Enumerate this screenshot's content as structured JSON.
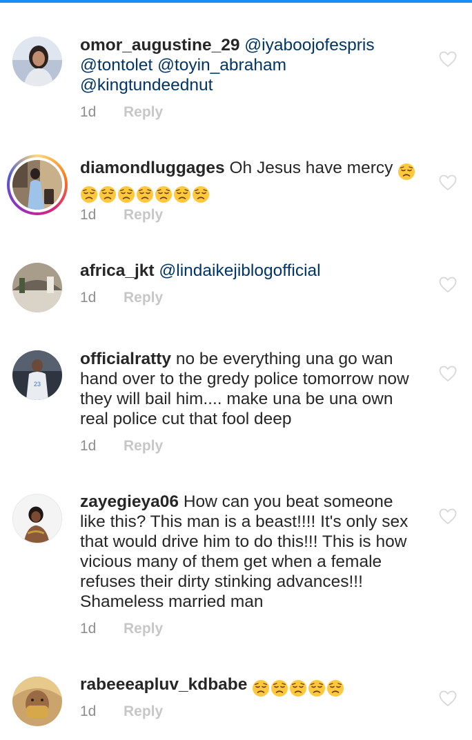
{
  "comments": [
    {
      "username": "omor_augustine_29",
      "mentions": [
        "@iyaboojofespris",
        "@tontolet",
        "@toyin_abraham",
        "@kingtundeednut"
      ],
      "time": "1d",
      "reply_label": "Reply"
    },
    {
      "username": "diamondluggages",
      "text": "Oh Jesus have mercy",
      "emoji_name": "disappointed-face-emoji",
      "emoji_count": 8,
      "time": "1d",
      "reply_label": "Reply",
      "has_story_ring": true
    },
    {
      "username": "africa_jkt",
      "mentions": [
        "@lindaikejiblogofficial"
      ],
      "time": "1d",
      "reply_label": "Reply"
    },
    {
      "username": "officialratty",
      "text_lines": [
        "no be everything una go wan",
        "hand over to the gredy police tomorrow now",
        "they will bail him.... make una be una own",
        "real police cut that fool deep"
      ],
      "time": "1d",
      "reply_label": "Reply"
    },
    {
      "username": "zayegieya06",
      "text_lines": [
        "How can you beat someone",
        "like this? This man is a beast!!!! It's only sex",
        "that would drive him to do this!!! This is how",
        "vicious many of them get when a female",
        "refuses their dirty stinking advances!!!",
        "Shameless married man"
      ],
      "time": "1d",
      "reply_label": "Reply"
    },
    {
      "username": "rabeeeapluv_kdbabe",
      "emoji_name": "disappointed-face-emoji",
      "emoji_count": 5,
      "time": "1d",
      "reply_label": "Reply"
    }
  ],
  "colors": {
    "accent_bar": "#1a8cf0",
    "username": "#262626",
    "mention": "#003569",
    "meta": "#8e8e8e",
    "reply": "#c7c7c7",
    "heart": "#d8d8d8"
  }
}
